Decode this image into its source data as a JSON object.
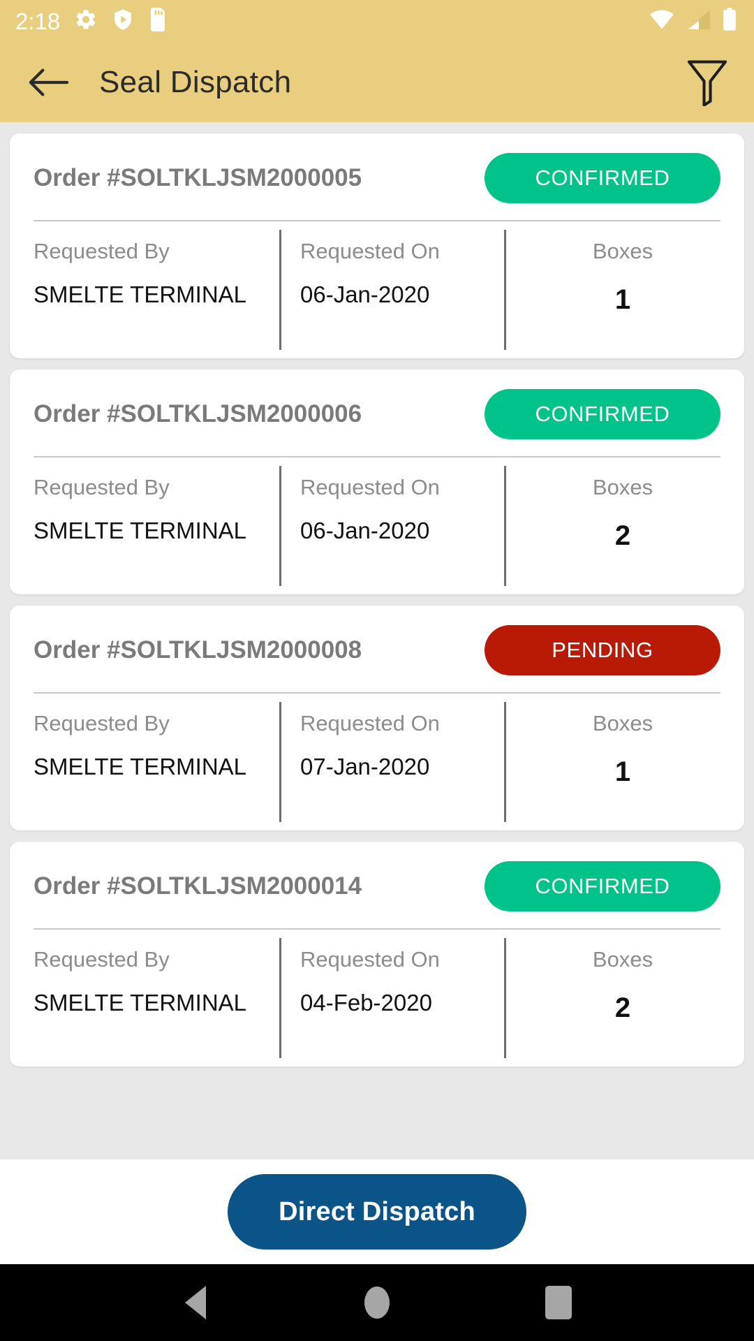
{
  "status_bar": {
    "time": "2:18",
    "left_icons": [
      "gear-icon",
      "shield-play-icon",
      "sd-card-icon"
    ],
    "right_icons": [
      "wifi-icon",
      "signal-icon",
      "battery-icon"
    ],
    "background_color": "#E8CE7E",
    "icon_color": "#FFFFFF"
  },
  "app_bar": {
    "back_icon": "back-arrow-icon",
    "title": "Seal Dispatch",
    "filter_icon": "funnel-filter-icon",
    "background_color": "#E8CE7E",
    "title_color": "#2B2B2B"
  },
  "list": {
    "labels": {
      "requested_by": "Requested By",
      "requested_on": "Requested On",
      "boxes": "Boxes"
    },
    "status_colors": {
      "CONFIRMED": "#00C389",
      "PENDING": "#B81A06"
    },
    "orders": [
      {
        "order_id": "Order #SOLTKLJSM2000005",
        "status": "CONFIRMED",
        "requested_by": "SMELTE TERMINAL",
        "requested_on": "06-Jan-2020",
        "boxes": "1"
      },
      {
        "order_id": "Order #SOLTKLJSM2000006",
        "status": "CONFIRMED",
        "requested_by": "SMELTE TERMINAL",
        "requested_on": "06-Jan-2020",
        "boxes": "2"
      },
      {
        "order_id": "Order #SOLTKLJSM2000008",
        "status": "PENDING",
        "requested_by": "SMELTE TERMINAL",
        "requested_on": "07-Jan-2020",
        "boxes": "1"
      },
      {
        "order_id": "Order #SOLTKLJSM2000014",
        "status": "CONFIRMED",
        "requested_by": "SMELTE TERMINAL",
        "requested_on": "04-Feb-2020",
        "boxes": "2"
      }
    ]
  },
  "bottom_action": {
    "label": "Direct Dispatch",
    "color": "#0B5488"
  },
  "navigation_bar": {
    "back": "nav-back-icon",
    "home": "nav-home-icon",
    "recent": "nav-recent-apps-icon",
    "background_color": "#000000",
    "icon_color": "#A6A6A6"
  }
}
